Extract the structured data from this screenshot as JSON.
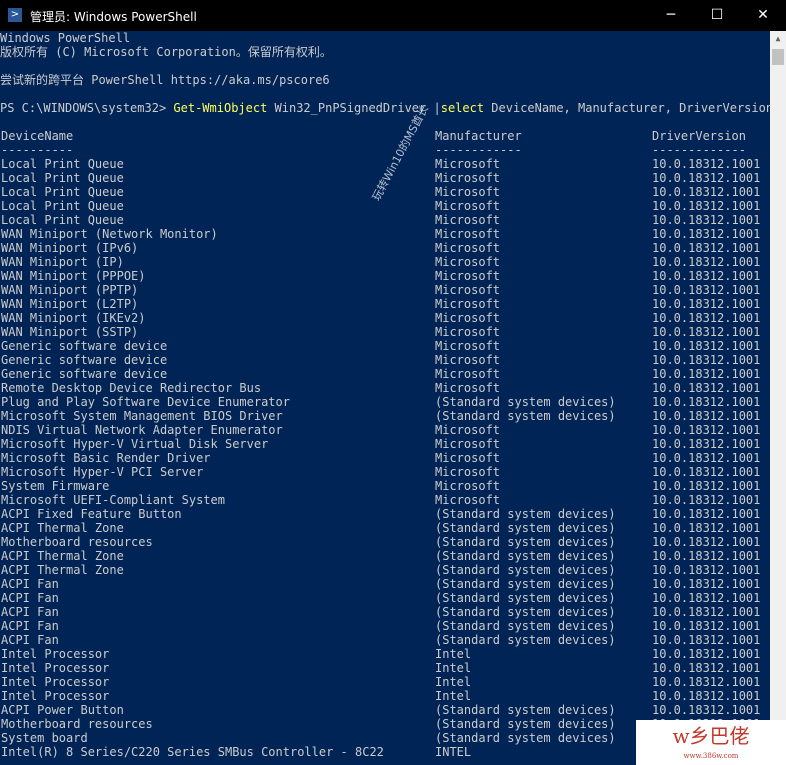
{
  "window": {
    "title": "管理员: Windows PowerShell",
    "minimize": "─",
    "maximize": "☐",
    "close": "✕"
  },
  "banner": [
    "Windows PowerShell",
    "版权所有 (C) Microsoft Corporation。保留所有权利。",
    "",
    "尝试新的跨平台 PowerShell https://aka.ms/pscore6",
    ""
  ],
  "prompt": {
    "path": "PS C:\\WINDOWS\\system32> ",
    "cmdlet": "Get-WmiObject",
    "arg1": " Win32_PnPSignedDriver ",
    "pipe": "|",
    "select": "select",
    "args": " DeviceName, Manufacturer, DriverVersion"
  },
  "headers": [
    "DeviceName",
    "Manufacturer",
    "DriverVersion"
  ],
  "underlines": [
    "----------",
    "------------",
    "-------------"
  ],
  "rows": [
    [
      "Local Print Queue",
      "Microsoft",
      "10.0.18312.1001"
    ],
    [
      "Local Print Queue",
      "Microsoft",
      "10.0.18312.1001"
    ],
    [
      "Local Print Queue",
      "Microsoft",
      "10.0.18312.1001"
    ],
    [
      "Local Print Queue",
      "Microsoft",
      "10.0.18312.1001"
    ],
    [
      "Local Print Queue",
      "Microsoft",
      "10.0.18312.1001"
    ],
    [
      "WAN Miniport (Network Monitor)",
      "Microsoft",
      "10.0.18312.1001"
    ],
    [
      "WAN Miniport (IPv6)",
      "Microsoft",
      "10.0.18312.1001"
    ],
    [
      "WAN Miniport (IP)",
      "Microsoft",
      "10.0.18312.1001"
    ],
    [
      "WAN Miniport (PPPOE)",
      "Microsoft",
      "10.0.18312.1001"
    ],
    [
      "WAN Miniport (PPTP)",
      "Microsoft",
      "10.0.18312.1001"
    ],
    [
      "WAN Miniport (L2TP)",
      "Microsoft",
      "10.0.18312.1001"
    ],
    [
      "WAN Miniport (IKEv2)",
      "Microsoft",
      "10.0.18312.1001"
    ],
    [
      "WAN Miniport (SSTP)",
      "Microsoft",
      "10.0.18312.1001"
    ],
    [
      "Generic software device",
      "Microsoft",
      "10.0.18312.1001"
    ],
    [
      "Generic software device",
      "Microsoft",
      "10.0.18312.1001"
    ],
    [
      "Generic software device",
      "Microsoft",
      "10.0.18312.1001"
    ],
    [
      "Remote Desktop Device Redirector Bus",
      "Microsoft",
      "10.0.18312.1001"
    ],
    [
      "Plug and Play Software Device Enumerator",
      "(Standard system devices)",
      "10.0.18312.1001"
    ],
    [
      "Microsoft System Management BIOS Driver",
      "(Standard system devices)",
      "10.0.18312.1001"
    ],
    [
      "NDIS Virtual Network Adapter Enumerator",
      "Microsoft",
      "10.0.18312.1001"
    ],
    [
      "Microsoft Hyper-V Virtual Disk Server",
      "Microsoft",
      "10.0.18312.1001"
    ],
    [
      "Microsoft Basic Render Driver",
      "Microsoft",
      "10.0.18312.1001"
    ],
    [
      "Microsoft Hyper-V PCI Server",
      "Microsoft",
      "10.0.18312.1001"
    ],
    [
      "System Firmware",
      "Microsoft",
      "10.0.18312.1001"
    ],
    [
      "Microsoft UEFI-Compliant System",
      "Microsoft",
      "10.0.18312.1001"
    ],
    [
      "ACPI Fixed Feature Button",
      "(Standard system devices)",
      "10.0.18312.1001"
    ],
    [
      "ACPI Thermal Zone",
      "(Standard system devices)",
      "10.0.18312.1001"
    ],
    [
      "Motherboard resources",
      "(Standard system devices)",
      "10.0.18312.1001"
    ],
    [
      "ACPI Thermal Zone",
      "(Standard system devices)",
      "10.0.18312.1001"
    ],
    [
      "ACPI Thermal Zone",
      "(Standard system devices)",
      "10.0.18312.1001"
    ],
    [
      "ACPI Fan",
      "(Standard system devices)",
      "10.0.18312.1001"
    ],
    [
      "ACPI Fan",
      "(Standard system devices)",
      "10.0.18312.1001"
    ],
    [
      "ACPI Fan",
      "(Standard system devices)",
      "10.0.18312.1001"
    ],
    [
      "ACPI Fan",
      "(Standard system devices)",
      "10.0.18312.1001"
    ],
    [
      "ACPI Fan",
      "(Standard system devices)",
      "10.0.18312.1001"
    ],
    [
      "Intel Processor",
      "Intel",
      "10.0.18312.1001"
    ],
    [
      "Intel Processor",
      "Intel",
      "10.0.18312.1001"
    ],
    [
      "Intel Processor",
      "Intel",
      "10.0.18312.1001"
    ],
    [
      "Intel Processor",
      "Intel",
      "10.0.18312.1001"
    ],
    [
      "ACPI Power Button",
      "(Standard system devices)",
      "10.0.18312.1001"
    ],
    [
      "Motherboard resources",
      "(Standard system devices)",
      "10.0.18312.1001"
    ],
    [
      "System board",
      "(Standard system devices)",
      "10.0.18312.1001"
    ],
    [
      "Intel(R) 8 Series/C220 Series SMBus Controller - 8C22",
      "INTEL",
      ""
    ]
  ],
  "watermark": "玩转Win10的MS酋长",
  "logo": {
    "text": "w乡巴佬",
    "url": "www.386w.com"
  },
  "colors": {
    "background": "#012456",
    "text": "#cccccc",
    "cmdlet": "#ffff55"
  }
}
